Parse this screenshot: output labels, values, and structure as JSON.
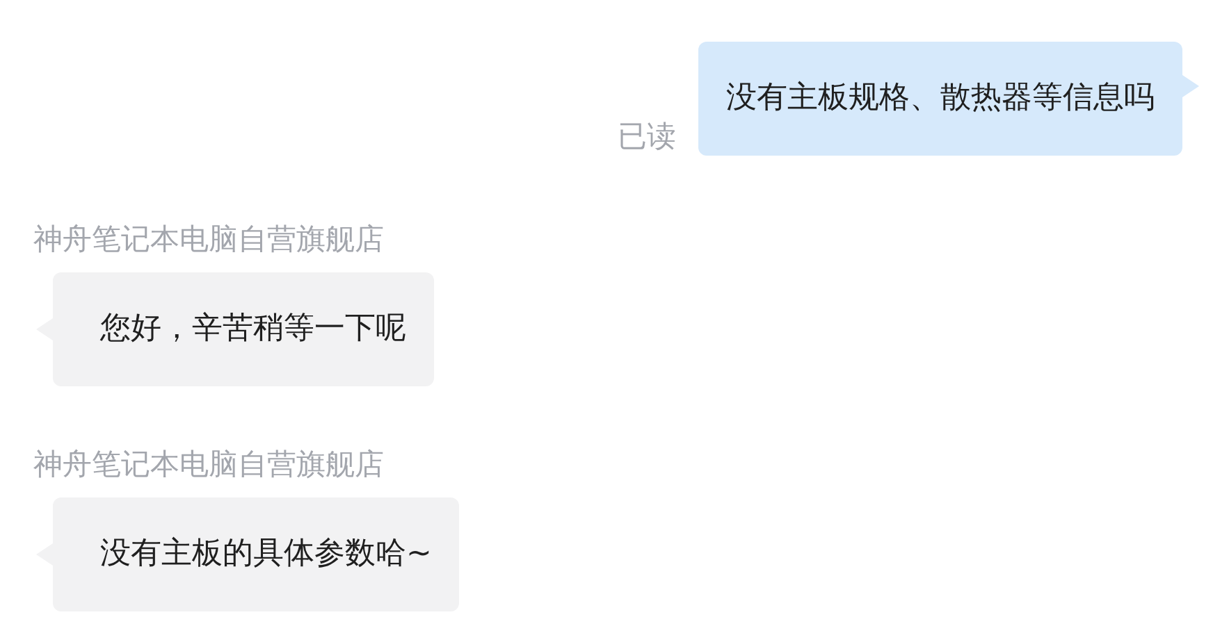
{
  "messages": [
    {
      "kind": "outgoing",
      "text": "没有主板规格、散热器等信息吗",
      "read_label": "已读"
    },
    {
      "kind": "incoming",
      "sender": "神舟笔记本电脑自营旗舰店",
      "text": "您好，辛苦稍等一下呢"
    },
    {
      "kind": "incoming",
      "sender": "神舟笔记本电脑自营旗舰店",
      "text": "没有主板的具体参数哈~"
    }
  ]
}
